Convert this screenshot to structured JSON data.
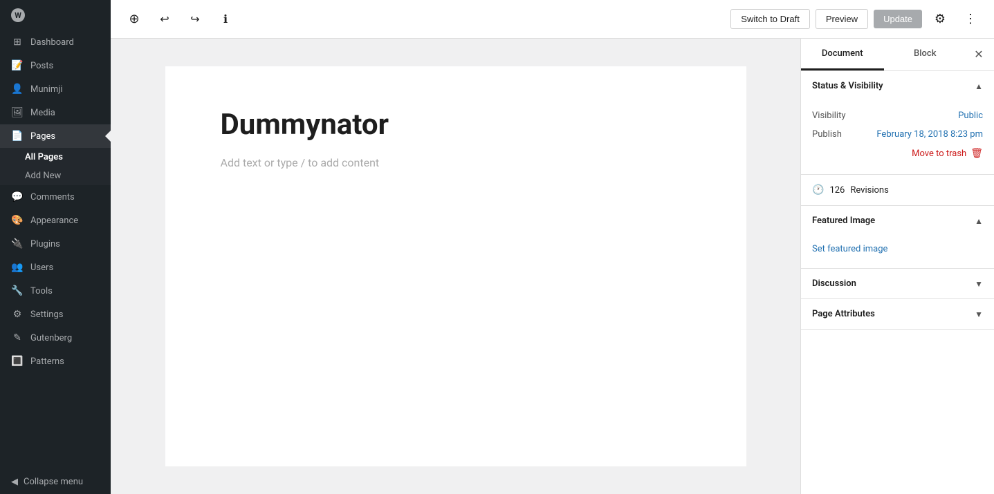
{
  "sidebar": {
    "logo_label": "W",
    "items": [
      {
        "id": "dashboard",
        "label": "Dashboard",
        "icon": "⊞"
      },
      {
        "id": "posts",
        "label": "Posts",
        "icon": "📝"
      },
      {
        "id": "munimji",
        "label": "Munimji",
        "icon": "👤"
      },
      {
        "id": "media",
        "label": "Media",
        "icon": "🖼"
      },
      {
        "id": "pages",
        "label": "Pages",
        "icon": "📄",
        "active": true
      },
      {
        "id": "comments",
        "label": "Comments",
        "icon": "💬"
      },
      {
        "id": "appearance",
        "label": "Appearance",
        "icon": "🎨"
      },
      {
        "id": "plugins",
        "label": "Plugins",
        "icon": "🔌"
      },
      {
        "id": "users",
        "label": "Users",
        "icon": "👥"
      },
      {
        "id": "tools",
        "label": "Tools",
        "icon": "🔧"
      },
      {
        "id": "settings",
        "label": "Settings",
        "icon": "⚙"
      },
      {
        "id": "gutenberg",
        "label": "Gutenberg",
        "icon": "✎"
      },
      {
        "id": "patterns",
        "label": "Patterns",
        "icon": "🔳"
      }
    ],
    "sub_items": [
      {
        "id": "all-pages",
        "label": "All Pages",
        "active": true
      },
      {
        "id": "add-new",
        "label": "Add New"
      }
    ],
    "collapse_label": "Collapse menu"
  },
  "toolbar": {
    "add_label": "+",
    "undo_label": "↩",
    "redo_label": "↪",
    "info_label": "ℹ",
    "switch_draft_label": "Switch to Draft",
    "preview_label": "Preview",
    "update_label": "Update",
    "settings_label": "⚙",
    "more_label": "⋮"
  },
  "editor": {
    "title": "Dummynator",
    "placeholder": "Add text or type / to add content"
  },
  "right_panel": {
    "tabs": [
      {
        "id": "document",
        "label": "Document",
        "active": true
      },
      {
        "id": "block",
        "label": "Block"
      }
    ],
    "close_label": "✕",
    "status_section": {
      "title": "Status & Visibility",
      "visibility_label": "Visibility",
      "visibility_value": "Public",
      "publish_label": "Publish",
      "publish_value": "February 18, 2018 8:23 pm",
      "move_trash_label": "Move to trash",
      "trash_icon": "🗑"
    },
    "revisions": {
      "icon": "🕐",
      "count": "126",
      "label": "Revisions"
    },
    "featured_image": {
      "title": "Featured Image",
      "set_label": "Set featured image"
    },
    "discussion": {
      "title": "Discussion"
    },
    "page_attributes": {
      "title": "Page Attributes"
    }
  }
}
